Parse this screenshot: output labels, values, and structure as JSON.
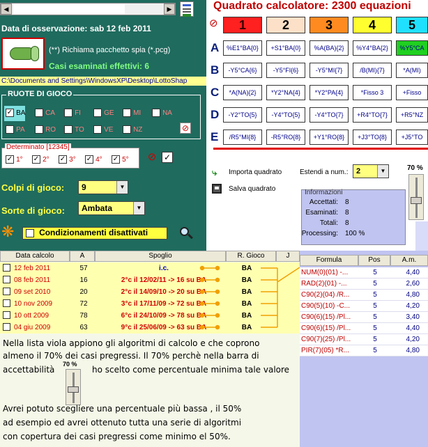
{
  "left": {
    "data_label": "Data di osservazione:  sab 12 feb 2011",
    "spy_text": "(**) Richiama pacchetto spia (*.pcg)",
    "casi_label": "Casi esaminati effettivi: 6",
    "path": "C:\\Documents and Settings\\WindowsXP\\Desktop\\LottoShap",
    "ruote_title": "RUOTE DI GIOCO",
    "ruote": [
      "BA",
      "CA",
      "FI",
      "GE",
      "MI",
      "NA",
      "PA",
      "RO",
      "TO",
      "VE",
      "NZ"
    ],
    "determinato_title": "Determinato [12345]",
    "determinato": [
      "1°",
      "2°",
      "3°",
      "4°",
      "5°"
    ],
    "colpi_label": "Colpi di gioco:",
    "colpi_value": "9",
    "sorte_label": "Sorte di gioco:",
    "sorte_value": "Ambata",
    "condizionamenti": "Condizionamenti disattivati"
  },
  "right": {
    "title": "Quadrato calcolatore: 2300 equazioni",
    "columns": [
      "1",
      "2",
      "3",
      "4",
      "5"
    ],
    "rows": [
      {
        "label": "A",
        "cells": [
          "%E1°BA{0}",
          "+S1°BA{0}",
          "%A(BA){2}",
          "%Y4°BA{2}",
          "%Y5°CA"
        ]
      },
      {
        "label": "B",
        "cells": [
          "-Y5°CA{6}",
          "-Y5°FI{6}",
          "-Y5°MI{7}",
          "/B(MI){7}",
          "*A(MI)"
        ]
      },
      {
        "label": "C",
        "cells": [
          "*A(NA){2}",
          "*Y2°NA{4}",
          "*Y2°PA{4}",
          "*Fisso 3",
          "+Fisso"
        ]
      },
      {
        "label": "D",
        "cells": [
          "-Y2°TO{5}",
          "-Y4°TO{5}",
          "-Y4°TO{7}",
          "+R4°TO{7}",
          "+R5°NZ"
        ]
      },
      {
        "label": "E",
        "cells": [
          "/R5°MI{8}",
          "-R5°RO{8}",
          "+Y1°RO{8}",
          "+J3°TO{8}",
          "+J5°TO"
        ]
      }
    ],
    "importa": "Importa quadrato",
    "salva": "Salva quadrato",
    "estendi_label": "Estendi a num.:",
    "estendi_value": "2",
    "slider_value": "70 %",
    "info_title": "Informazioni",
    "info": [
      {
        "k": "Accettati:",
        "v": "8"
      },
      {
        "k": "Esaminati:",
        "v": "8"
      },
      {
        "k": "Totali:",
        "v": "8"
      },
      {
        "k": "Processing:",
        "v": "100 %"
      }
    ]
  },
  "table": {
    "headers": [
      "Data calcolo",
      "A",
      "Spoglio",
      "R. Gioco",
      "J"
    ],
    "rows": [
      {
        "data": "12 feb 2011",
        "a": "57",
        "spoglio": "i.c.",
        "gioco": "BA"
      },
      {
        "data": "08 feb 2011",
        "a": "16",
        "spoglio": "2°c il 12/02/11 -> 16 su BA",
        "gioco": "BA"
      },
      {
        "data": "09 set 2010",
        "a": "20",
        "spoglio": "2°c il 14/09/10 -> 20 su BA",
        "gioco": "BA"
      },
      {
        "data": "10 nov 2009",
        "a": "72",
        "spoglio": "3°c il 17/11/09 -> 72 su BA",
        "gioco": "BA"
      },
      {
        "data": "10 ott 2009",
        "a": "78",
        "spoglio": "6°c il 24/10/09 -> 78 su BA",
        "gioco": "BA"
      },
      {
        "data": "04 giu 2009",
        "a": "63",
        "spoglio": "9°c il 25/06/09 -> 63 su BA",
        "gioco": "BA"
      }
    ],
    "note1_a": "Nella lista viola appiono gli algoritmi di calcolo e che coprono",
    "note1_b": "almeno il 70% dei casi pregressi. Il 70% perchè nella barra di",
    "note1_c": "accettabilità",
    "note1_d": "ho scelto come percentuale minima tale valore",
    "mini_slider": "70 %",
    "note2_a": "Avrei potuto scegliere una percentuale più bassa , il 50%",
    "note2_b": "ad esempio ed avrei ottenuto tutta una serie di algoritmi",
    "note2_c": "con copertura dei casi pregressi come    minimo el 50%."
  },
  "list": {
    "headers": [
      "Formula",
      "Pos",
      "A.m."
    ],
    "rows": [
      {
        "f": "NUM(0)(01) -...",
        "p": "5",
        "m": "4,40"
      },
      {
        "f": "RAD(2)(01) -...",
        "p": "5",
        "m": "2,60"
      },
      {
        "f": "C90(2)(04) /R...",
        "p": "5",
        "m": "4,80"
      },
      {
        "f": "C90(5)(10) -C...",
        "p": "5",
        "m": "4,20"
      },
      {
        "f": "C90(6)(15) /Pl...",
        "p": "5",
        "m": "3,40"
      },
      {
        "f": "C90(6)(15) /Pl...",
        "p": "5",
        "m": "4,40"
      },
      {
        "f": "C90(7)(25) /Pl...",
        "p": "5",
        "m": "4,20"
      },
      {
        "f": "PIR(7)(05) *R...",
        "p": "5",
        "m": "4,80"
      }
    ]
  },
  "colors": {
    "green_panel": "#1f6b5e",
    "list_violet": "#c0c4f0",
    "table_yellow": "#ffffb0",
    "accent_red": "#d00000"
  }
}
